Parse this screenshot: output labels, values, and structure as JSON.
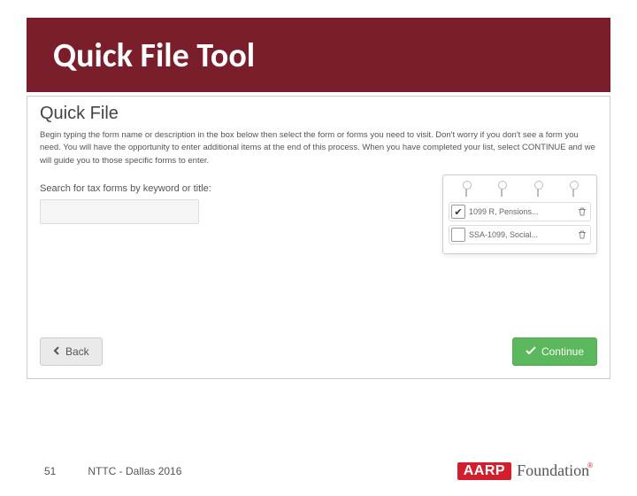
{
  "slide": {
    "title": "Quick File Tool",
    "page_number": "51",
    "footer_text": "NTTC - Dallas 2016",
    "logo": {
      "brand": "AARP",
      "sub": "Foundation",
      "reg": "®"
    }
  },
  "panel": {
    "title": "Quick File",
    "description": "Begin typing the form name or description in the box below then select the form or forms you need to visit. Don't worry if you don't see a form you need. You will have the opportunity to enter additional items at the end of this process. When you have completed your list, select CONTINUE and we will guide you to those specific forms to enter.",
    "search_label": "Search for tax forms by keyword or title:",
    "search_value": "",
    "back_label": "Back",
    "continue_label": "Continue"
  },
  "forms": [
    {
      "checked": true,
      "label": "1099 R, Pensions..."
    },
    {
      "checked": false,
      "label": "SSA-1099, Social..."
    }
  ]
}
